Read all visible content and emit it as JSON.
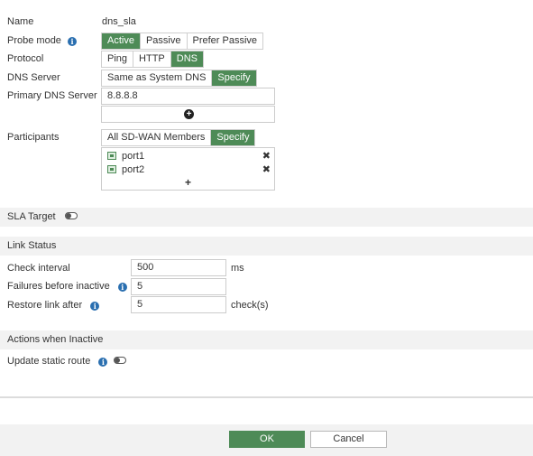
{
  "form": {
    "name": {
      "label": "Name",
      "value": "dns_sla"
    },
    "probe_mode": {
      "label": "Probe mode",
      "info_icon": "info-icon",
      "options": [
        "Active",
        "Passive",
        "Prefer Passive"
      ],
      "selected": "Active"
    },
    "protocol": {
      "label": "Protocol",
      "options": [
        "Ping",
        "HTTP",
        "DNS"
      ],
      "selected": "DNS"
    },
    "dns_server": {
      "label": "DNS Server",
      "options": [
        "Same as System DNS",
        "Specify"
      ],
      "selected": "Specify"
    },
    "primary_dns": {
      "label": "Primary DNS Server",
      "value": "8.8.8.8",
      "add_icon": "plus-circle-icon"
    },
    "participants": {
      "label": "Participants",
      "options": [
        "All SD-WAN Members",
        "Specify"
      ],
      "selected": "Specify",
      "members": [
        {
          "name": "port1",
          "icon": "interface-icon"
        },
        {
          "name": "port2",
          "icon": "interface-icon"
        }
      ],
      "add_symbol": "+"
    }
  },
  "sla_target": {
    "label": "SLA Target",
    "enabled": false
  },
  "link_status": {
    "title": "Link Status",
    "check_interval": {
      "label": "Check interval",
      "value": "500",
      "unit": "ms"
    },
    "failures_before_inactive": {
      "label": "Failures before inactive",
      "value": "5"
    },
    "restore_link_after": {
      "label": "Restore link after",
      "value": "5",
      "unit": "check(s)"
    }
  },
  "actions_inactive": {
    "title": "Actions when Inactive",
    "update_static_route": {
      "label": "Update static route",
      "enabled": false
    }
  },
  "footer": {
    "ok_label": "OK",
    "cancel_label": "Cancel"
  },
  "colors": {
    "accent": "#4e8b57",
    "info": "#2a6fb0",
    "section_bg": "#f2f2f2"
  }
}
